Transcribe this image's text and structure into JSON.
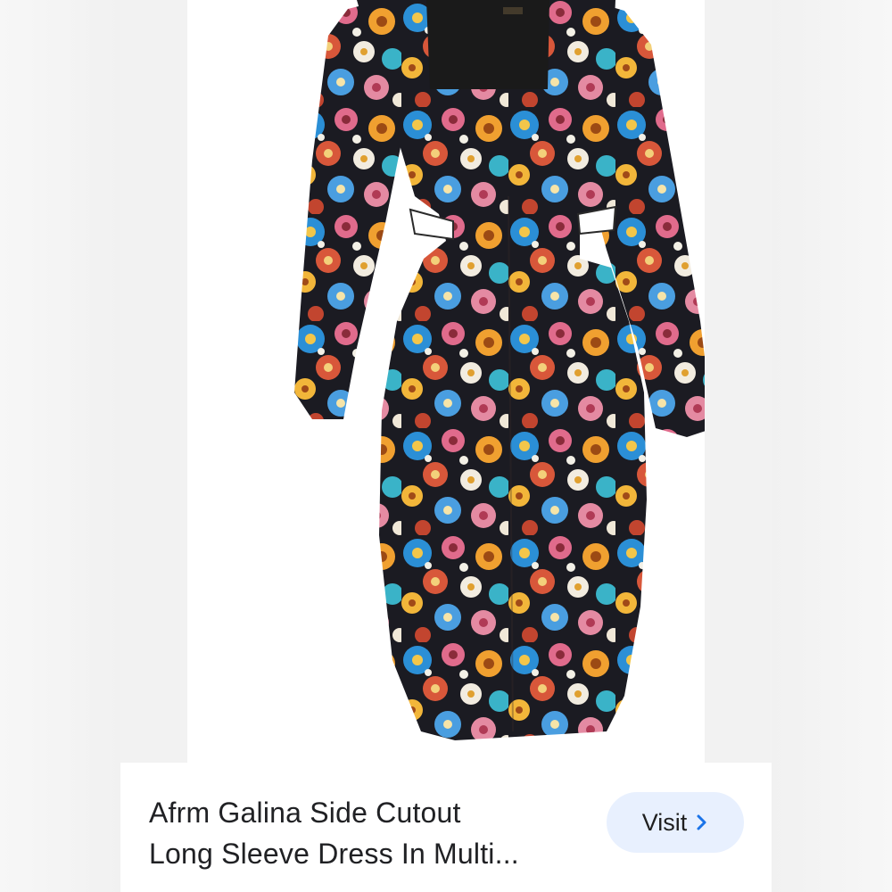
{
  "product": {
    "title_line1": "Afrm Galina Side Cutout",
    "title_line2": "Long Sleeve Dress In Multi...",
    "image_label_icon": "dress-photo"
  },
  "actions": {
    "visit_label": "Visit",
    "visit_icon": "chevron-right-icon"
  },
  "colors": {
    "accent_button_bg": "#e8f0fe",
    "chevron": "#1a73e8",
    "title_text": "#202124",
    "dress_bodice": "#1a1a1a"
  }
}
